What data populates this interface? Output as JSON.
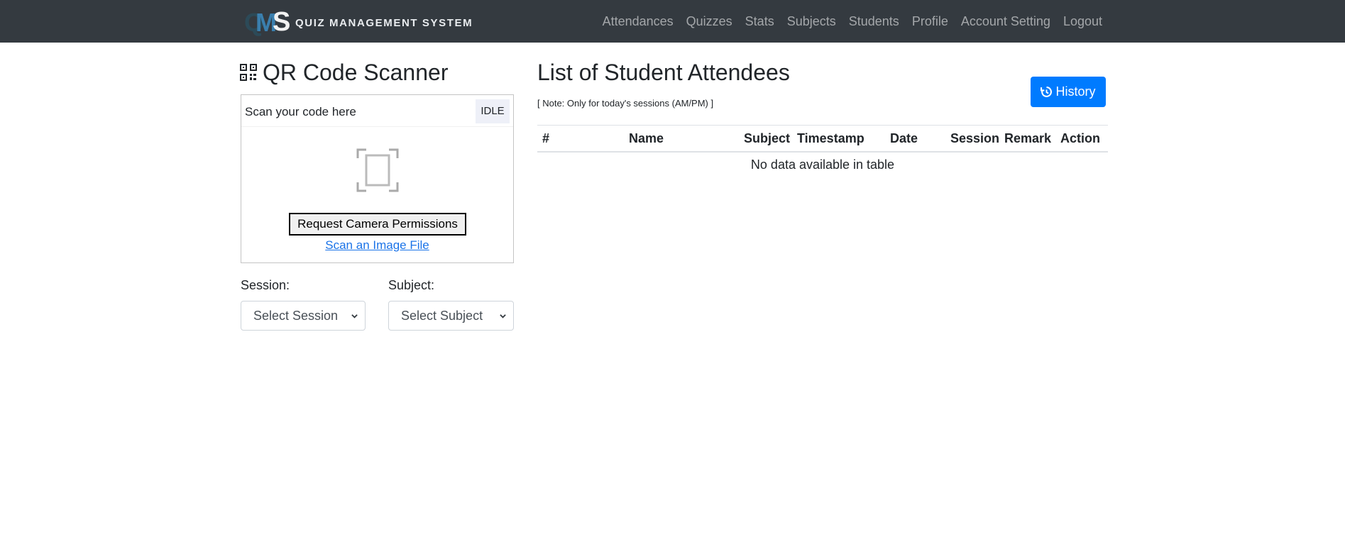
{
  "navbar": {
    "brand_text": "QUIZ MANAGEMENT SYSTEM",
    "logo_letters": [
      "Q",
      "M",
      "S"
    ],
    "items": [
      "Attendances",
      "Quizzes",
      "Stats",
      "Subjects",
      "Students",
      "Profile",
      "Account Setting",
      "Logout"
    ]
  },
  "scanner": {
    "title": "QR Code Scanner",
    "prompt": "Scan your code here",
    "status": "IDLE",
    "permission_button": "Request Camera Permissions",
    "scan_file_link": "Scan an Image File"
  },
  "filters": {
    "session_label": "Session:",
    "session_value": "Select Session",
    "subject_label": "Subject:",
    "subject_value": "Select Subject"
  },
  "attendees": {
    "title": "List of Student Attendees",
    "note": "[ Note: Only for today's sessions (AM/PM) ]",
    "history_button": "History",
    "columns": [
      "#",
      "Name",
      "Subject",
      "Timestamp",
      "Date",
      "Session",
      "Remark",
      "Action"
    ],
    "empty_message": "No data available in table"
  },
  "colors": {
    "navbar_bg": "#343a40",
    "primary": "#007bff",
    "link": "#1a73e8"
  }
}
